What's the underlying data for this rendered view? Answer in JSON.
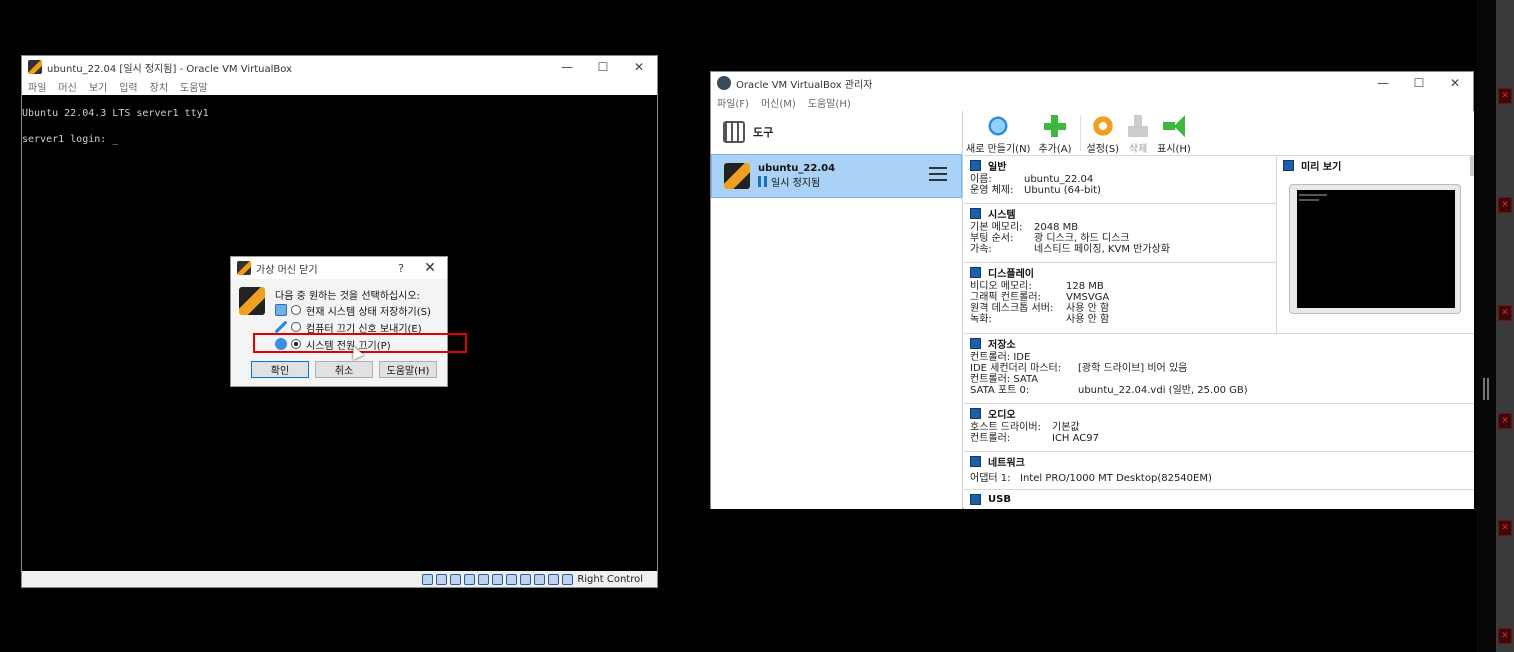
{
  "console_window": {
    "title": "ubuntu_22.04 [일시 정지됨] - Oracle VM VirtualBox",
    "menu": [
      "파일",
      "머신",
      "보기",
      "입력",
      "장치",
      "도움말"
    ],
    "screen_lines": [
      "Ubuntu 22.04.3 LTS server1 tty1",
      "server1 login: _"
    ],
    "host_key": "Right Control"
  },
  "close_dialog": {
    "title": "가상 머신 닫기",
    "help_glyph": "?",
    "prompt": "다음 중 원하는 것을 선택하십시오:",
    "options": [
      {
        "label": "현재 시스템 상태 저장하기(S)",
        "selected": false
      },
      {
        "label": "컴퓨터 끄기 신호 보내기(E)",
        "selected": false
      },
      {
        "label": "시스템 전원 끄기(P)",
        "selected": true
      }
    ],
    "buttons": {
      "ok": "확인",
      "cancel": "취소",
      "help": "도움말(H)"
    }
  },
  "manager": {
    "title": "Oracle VM VirtualBox 관리자",
    "menu": [
      "파일(F)",
      "머신(M)",
      "도움말(H)"
    ],
    "tools_label": "도구",
    "vm": {
      "name": "ubuntu_22.04",
      "state": "일시 정지됨"
    },
    "toolbar": [
      {
        "label": "새로 만들기(N)",
        "icon": "new-icon",
        "enabled": true
      },
      {
        "label": "추가(A)",
        "icon": "add-icon",
        "enabled": true
      },
      {
        "label": "설정(S)",
        "icon": "settings-icon",
        "enabled": true
      },
      {
        "label": "삭제",
        "icon": "discard-icon",
        "enabled": false
      },
      {
        "label": "표시(H)",
        "icon": "show-icon",
        "enabled": true
      }
    ],
    "sections": {
      "general": {
        "title": "일반",
        "rows": [
          [
            "이름:",
            "ubuntu_22.04"
          ],
          [
            "운영 체제:",
            "Ubuntu (64-bit)"
          ]
        ]
      },
      "system": {
        "title": "시스템",
        "rows": [
          [
            "기본 메모리:",
            "2048 MB"
          ],
          [
            "부팅 순서:",
            "광 디스크, 하드 디스크"
          ],
          [
            "가속:",
            "네스티드 페이징, KVM 반가상화"
          ]
        ]
      },
      "display": {
        "title": "디스플레이",
        "rows": [
          [
            "비디오 메모리:",
            "128 MB"
          ],
          [
            "그래픽 컨트롤러:",
            "VMSVGA"
          ],
          [
            "원격 데스크톱 서버:",
            "사용 안 함"
          ],
          [
            "녹화:",
            "사용 안 함"
          ]
        ]
      },
      "storage": {
        "title": "저장소",
        "rows": [
          [
            "컨트롤러: IDE",
            ""
          ],
          [
            " IDE 세컨더리 마스터:",
            "[광학 드라이브] 비어 있음"
          ],
          [
            "컨트롤러: SATA",
            ""
          ],
          [
            " SATA 포트 0:",
            "ubuntu_22.04.vdi (일반, 25.00 GB)"
          ]
        ]
      },
      "audio": {
        "title": "오디오",
        "rows": [
          [
            "호스트 드라이버:",
            "기본값"
          ],
          [
            "컨트롤러:",
            "ICH AC97"
          ]
        ]
      },
      "network": {
        "title": "네트워크",
        "rows": [
          [
            "어댑터 1:",
            "Intel PRO/1000 MT Desktop(82540EM)"
          ]
        ]
      },
      "usb": {
        "title": "USB",
        "rows": []
      },
      "preview": {
        "title": "미리 보기"
      }
    }
  },
  "colors": {
    "highlight_box": "#e00000",
    "selected_vm": "#a9d2f6",
    "accent": "#1c5ea8"
  }
}
